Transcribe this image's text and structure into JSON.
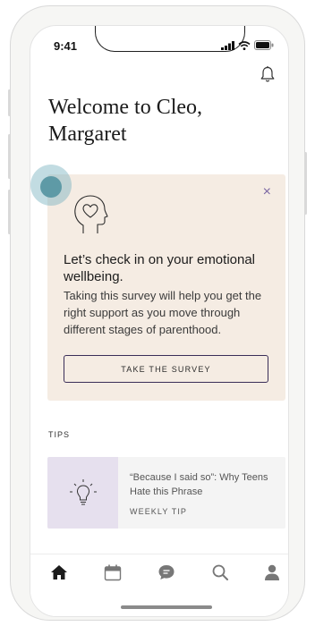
{
  "status_bar": {
    "time": "9:41"
  },
  "header": {
    "welcome_line1": "Welcome to Cleo,",
    "welcome_line2": "Margaret"
  },
  "survey_card": {
    "close_label": "×",
    "title": "Let’s check in on your emotional wellbeing.",
    "body": "Taking this survey will help you get the right support as you move through different stages of parenthood.",
    "button_label": "TAKE THE SURVEY"
  },
  "tips": {
    "section_label": "TIPS",
    "items": [
      {
        "title": "“Because I said so”: Why Teens Hate this Phrase",
        "tag": "WEEKLY TIP"
      }
    ]
  },
  "tab_bar": {
    "items": [
      {
        "icon": "home-icon",
        "active": true
      },
      {
        "icon": "calendar-icon",
        "active": false
      },
      {
        "icon": "chat-icon",
        "active": false
      },
      {
        "icon": "search-icon",
        "active": false
      },
      {
        "icon": "profile-icon",
        "active": false
      }
    ]
  },
  "colors": {
    "card_background": "#f5ece3",
    "accent_purple": "#7b67a3",
    "tip_thumb": "#e6e0ee",
    "cursor": "#5e9aa6"
  }
}
